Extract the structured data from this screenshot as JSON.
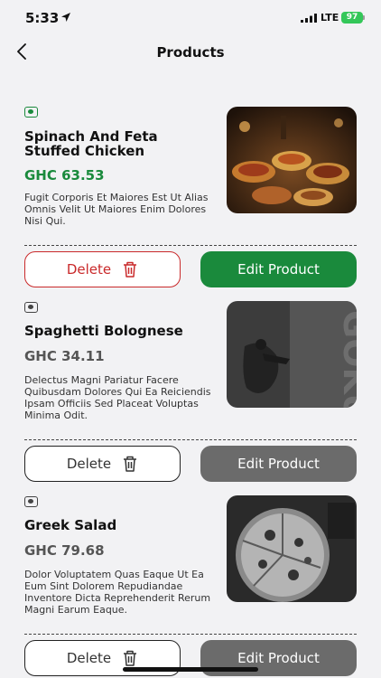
{
  "status_bar": {
    "time": "5:33",
    "network": "LTE",
    "battery": "97"
  },
  "header": {
    "title": "Products"
  },
  "delete_label": "Delete",
  "edit_label": "Edit Product",
  "products": [
    {
      "name": "Spinach And Feta Stuffed Chicken",
      "price": "GHC 63.53",
      "description": "Fugit Corporis Et Maiores Est Ut Alias Omnis Velit Ut Maiores Enim Dolores Nisi Qui.",
      "selected": true,
      "image": "food-spread-photo"
    },
    {
      "name": "Spaghetti Bolognese",
      "price": "GHC 34.11",
      "description": "Delectus Magni Pariatur Facere Quibusdam Dolores Qui Ea Reiciendis Ipsam Officiis Sed Placeat Voluptas Minima Odit.",
      "selected": false,
      "image": "dark-art-photo"
    },
    {
      "name": "Greek Salad",
      "price": "GHC 79.68",
      "description": "Dolor Voluptatem Quas Eaque Ut Ea Eum Sint Dolorem Repudiandae Inventore Dicta Reprehenderit Rerum Magni Earum Eaque.",
      "selected": false,
      "image": "pizza-photo"
    }
  ],
  "colors": {
    "accent_green": "#1a8a3c",
    "delete_red": "#c9292a",
    "disabled_gray": "#6b6b6b",
    "background": "#f2f2f4"
  }
}
